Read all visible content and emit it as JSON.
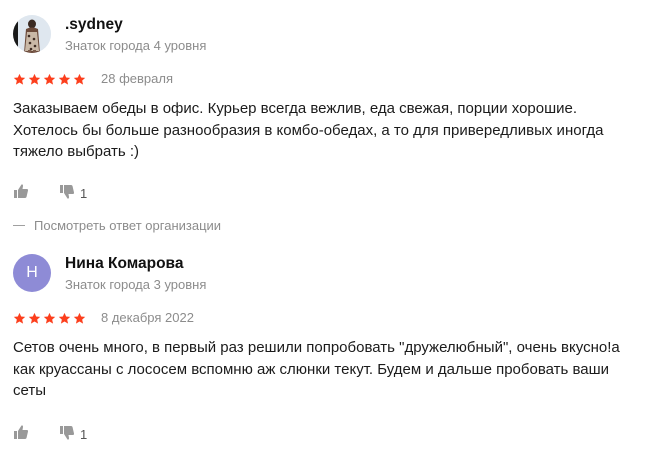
{
  "reviews": [
    {
      "author_name": ".sydney",
      "author_level": "Знаток города 4 уровня",
      "avatar_type": "photo",
      "rating": 5,
      "rating_max": 5,
      "date": "28 февраля",
      "text": "Заказываем обеды в офис. Курьер всегда вежлив, еда свежая, порции хорошие. Хотелось бы больше разнообразия в комбо-обедах, а то для привередливых иногда тяжело выбрать :)",
      "likes": "",
      "dislikes": "1",
      "org_response_label": "Посмотреть ответ организации"
    },
    {
      "author_name": "Нина Комарова",
      "author_level": "Знаток города 3 уровня",
      "avatar_type": "letter",
      "avatar_letter": "Н",
      "avatar_color": "#8e8bd6",
      "rating": 5,
      "rating_max": 5,
      "date": "8 декабря 2022",
      "text": "Сетов очень много, в первый раз решили попробовать \"дружелюбный\", очень вкусно!а как круассаны с лососем вспомню аж слюнки текут. Будем и дальше пробовать ваши сеты",
      "likes": "",
      "dislikes": "1"
    }
  ],
  "colors": {
    "star": "#fc3f1d",
    "text_secondary": "#8c8c8c",
    "icon": "#999999"
  }
}
